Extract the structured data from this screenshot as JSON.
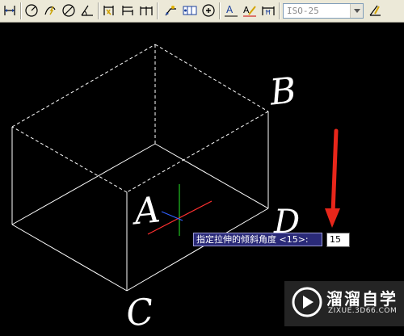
{
  "toolbar": {
    "dim_style_value": "ISO-25",
    "buttons": [
      "linear-dimension-icon",
      "arc-length-icon",
      "ordinate-icon",
      "radius-icon",
      "diameter-icon",
      "angular-icon",
      "quick-dimension-icon",
      "baseline-icon",
      "continue-icon",
      "leader-icon",
      "tolerance-icon",
      "center-mark-icon",
      "dimension-edit-icon",
      "dimension-text-edit-icon",
      "dimension-update-icon",
      "dimension-style-icon"
    ]
  },
  "drawing": {
    "label_a": "A",
    "label_b": "B",
    "label_c": "C",
    "label_d": "D",
    "line_color": "#ffffff",
    "arrow_color": "#e8261a",
    "crosshair_x_color": "#ff3030",
    "crosshair_y_color": "#21c321",
    "crosshair_z_color": "#3060ff"
  },
  "command": {
    "prompt": "指定拉伸的倾斜角度 <15>:",
    "input_value": "15"
  },
  "watermark": {
    "title": "溜溜自学",
    "url": "ZIXUE.3D66.COM"
  }
}
